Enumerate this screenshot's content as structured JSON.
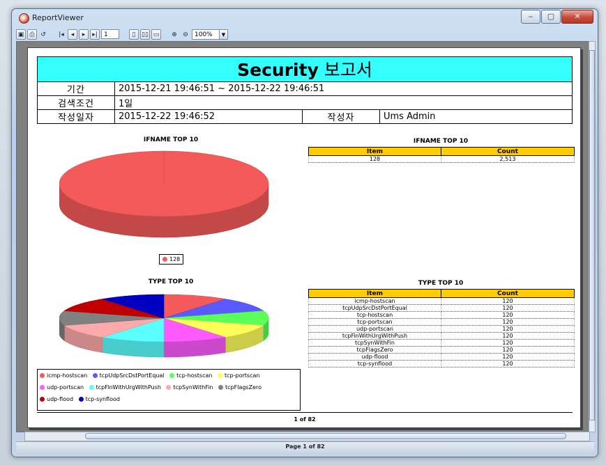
{
  "window": {
    "title": "ReportViewer",
    "minimize": "‒",
    "maximize": "▢",
    "close": "✕"
  },
  "toolbar": {
    "page_input": "1",
    "zoom": "100%"
  },
  "report": {
    "title_en": "Security",
    "title_ko": "보고서",
    "period_label": "기간",
    "period_value": "2015-12-21 19:46:51 ~ 2015-12-22 19:46:51",
    "criteria_label": "검색조건",
    "criteria_value": "1일",
    "created_label": "작성일자",
    "created_value": "2015-12-22 19:46:52",
    "author_label": "작성자",
    "author_value": "Ums Admin",
    "page_footer": "1 of 82"
  },
  "ifname_section": {
    "chart_title": "IFNAME TOP 10",
    "table_title": "IFNAME TOP 10",
    "col_item": "Item",
    "col_count": "Count",
    "rows": [
      {
        "item": "128",
        "count": "2,513"
      }
    ]
  },
  "type_section": {
    "chart_title": "TYPE TOP 10",
    "table_title": "TYPE TOP 10",
    "col_item": "Item",
    "col_count": "Count",
    "rows": [
      {
        "item": "icmp-hostscan",
        "count": "120"
      },
      {
        "item": "tcpUdpSrcDstPortEqual",
        "count": "120"
      },
      {
        "item": "tcp-hostscan",
        "count": "120"
      },
      {
        "item": "tcp-portscan",
        "count": "120"
      },
      {
        "item": "udp-portscan",
        "count": "120"
      },
      {
        "item": "tcpFinWithUrgWithPush",
        "count": "120"
      },
      {
        "item": "tcpSynWithFin",
        "count": "120"
      },
      {
        "item": "tcpFlagsZero",
        "count": "120"
      },
      {
        "item": "udp-flood",
        "count": "120"
      },
      {
        "item": "tcp-synflood",
        "count": "120"
      }
    ]
  },
  "chart_data": [
    {
      "type": "pie",
      "title": "IFNAME TOP 10",
      "categories": [
        "128"
      ],
      "values": [
        2513
      ],
      "colors": [
        "#f55a5a"
      ],
      "legend": "bottom"
    },
    {
      "type": "pie",
      "title": "TYPE TOP 10",
      "categories": [
        "icmp-hostscan",
        "tcpUdpSrcDstPortEqual",
        "tcp-hostscan",
        "tcp-portscan",
        "udp-portscan",
        "tcpFinWithUrgWithPush",
        "tcpSynWithFin",
        "tcpFlagsZero",
        "udp-flood",
        "tcp-synflood"
      ],
      "values": [
        120,
        120,
        120,
        120,
        120,
        120,
        120,
        120,
        120,
        120
      ],
      "colors": [
        "#f55a5a",
        "#5a5aff",
        "#5aff5a",
        "#ffff5a",
        "#ff5aff",
        "#5affff",
        "#ffaaaa",
        "#808080",
        "#c00000",
        "#0000c0"
      ],
      "legend": "bottom"
    }
  ],
  "status": {
    "text": "Page 1 of 82"
  }
}
